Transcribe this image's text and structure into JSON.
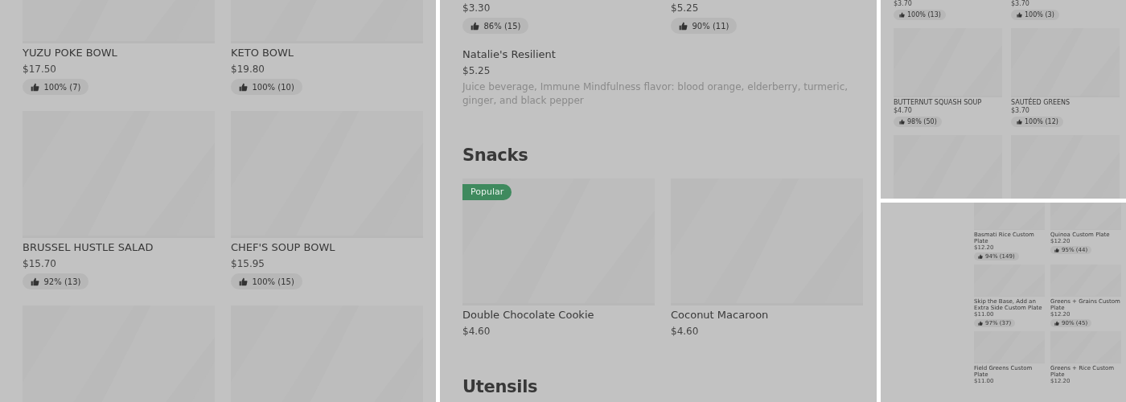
{
  "panels": [
    {
      "kind": "large",
      "sections": [
        {
          "items": [
            {
              "kind": "card",
              "name": "YUZU POKE BOWL",
              "price": "$17.50",
              "rating": "100% (7)"
            },
            {
              "kind": "card",
              "name": "KETO BOWL",
              "price": "$19.80",
              "rating": "100% (10)"
            },
            {
              "kind": "card",
              "name": "BRUSSEL HUSTLE SALAD",
              "price": "$15.70",
              "rating": "92% (13)"
            },
            {
              "kind": "card",
              "name": "CHEF'S SOUP BOWL",
              "price": "$15.95",
              "rating": "100% (15)"
            },
            {
              "kind": "picture"
            },
            {
              "kind": "picture"
            }
          ]
        }
      ]
    },
    {
      "kind": "medium",
      "sections": [
        {
          "items": [
            {
              "kind": "text",
              "price": "$3.30",
              "rating": "86% (15)"
            },
            {
              "kind": "text",
              "price": "$5.25",
              "rating": "90% (11)"
            }
          ]
        },
        {
          "items": [
            {
              "kind": "wide",
              "name": "Natalie's Resilient",
              "price": "$5.25",
              "description": "Juice beverage, Immune Mindfulness flavor: blood orange, elderberry, turmeric, ginger, and black pepper"
            }
          ]
        },
        {
          "heading": "Snacks",
          "items": [
            {
              "kind": "card",
              "badge": "Popular",
              "name": "Double Chocolate Cookie",
              "price": "$4.60"
            },
            {
              "kind": "card",
              "name": "Coconut Macaroon",
              "price": "$4.60"
            }
          ]
        },
        {
          "heading": "Utensils"
        }
      ]
    },
    {
      "kind": "small",
      "sections": [
        {
          "items": [
            {
              "kind": "text",
              "price": "$3.70",
              "rating": "100% (13)"
            },
            {
              "kind": "text",
              "price": "$3.70",
              "rating": "100% (3)"
            },
            {
              "kind": "card",
              "name": "BUTTERNUT SQUASH SOUP",
              "price": "$4.70",
              "rating": "98% (50)"
            },
            {
              "kind": "card",
              "name": "SAUTÉED GREENS",
              "price": "$3.70",
              "rating": "100% (12)"
            },
            {
              "kind": "picture"
            },
            {
              "kind": "picture"
            }
          ]
        }
      ]
    },
    {
      "kind": "tiny",
      "sections": [
        {
          "items": [
            {
              "kind": "card",
              "name": "Basmati Rice Custom Plate",
              "price": "$12.20",
              "rating": "94% (149)"
            },
            {
              "kind": "card",
              "name": "Quinoa Custom Plate",
              "price": "$12.20",
              "rating": "95% (44)"
            },
            {
              "kind": "card",
              "name": "Skip the Base, Add an Extra Side Custom Plate",
              "price": "$11.00",
              "rating": "97% (37)"
            },
            {
              "kind": "card",
              "name": "Greens + Grains Custom Plate",
              "price": "$12.20",
              "rating": "90% (45)"
            },
            {
              "kind": "card",
              "name": "Field Greens Custom Plate",
              "price": "$11.00"
            },
            {
              "kind": "card",
              "name": "Greens + Rice Custom Plate",
              "price": "$12.20"
            }
          ]
        }
      ]
    }
  ]
}
